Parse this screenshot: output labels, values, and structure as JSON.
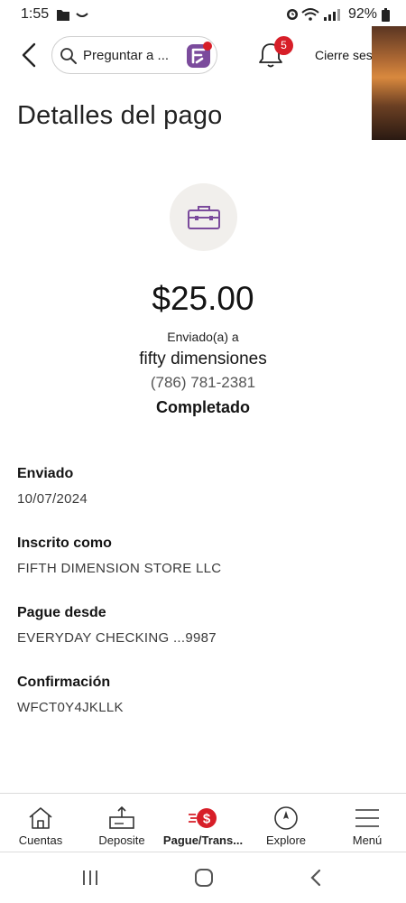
{
  "status_bar": {
    "time": "1:55",
    "battery": "92%",
    "icons": [
      "folder-icon",
      "minus-curve-icon",
      "alarm-icon",
      "wifi-icon",
      "signal-icon",
      "battery-icon"
    ]
  },
  "header": {
    "search_placeholder": "Preguntar a ...",
    "notification_count": "5",
    "signout_label": "Cierre ses"
  },
  "page": {
    "title": "Detalles del pago"
  },
  "payment": {
    "amount": "$25.00",
    "sent_to_label": "Enviado(a) a",
    "payee": "fifty dimensiones",
    "phone": "(786) 781-2381",
    "status": "Completado"
  },
  "details": [
    {
      "label": "Enviado",
      "value": "10/07/2024"
    },
    {
      "label": "Inscrito como",
      "value": "FIFTH DIMENSION STORE LLC"
    },
    {
      "label": "Pague desde",
      "value": "EVERYDAY CHECKING ...9987"
    },
    {
      "label": "Confirmación",
      "value": "WFCT0Y4JKLLK"
    }
  ],
  "bottom_nav": [
    {
      "label": "Cuentas",
      "icon": "home-icon"
    },
    {
      "label": "Deposite",
      "icon": "deposit-icon"
    },
    {
      "label": "Pague/Trans...",
      "icon": "pay-transfer-icon",
      "active": true
    },
    {
      "label": "Explore",
      "icon": "compass-icon"
    },
    {
      "label": "Menú",
      "icon": "menu-icon"
    }
  ],
  "colors": {
    "brand_red": "#d71e28",
    "accent_purple": "#7b4b9c",
    "icon_bg": "#f1efec"
  }
}
